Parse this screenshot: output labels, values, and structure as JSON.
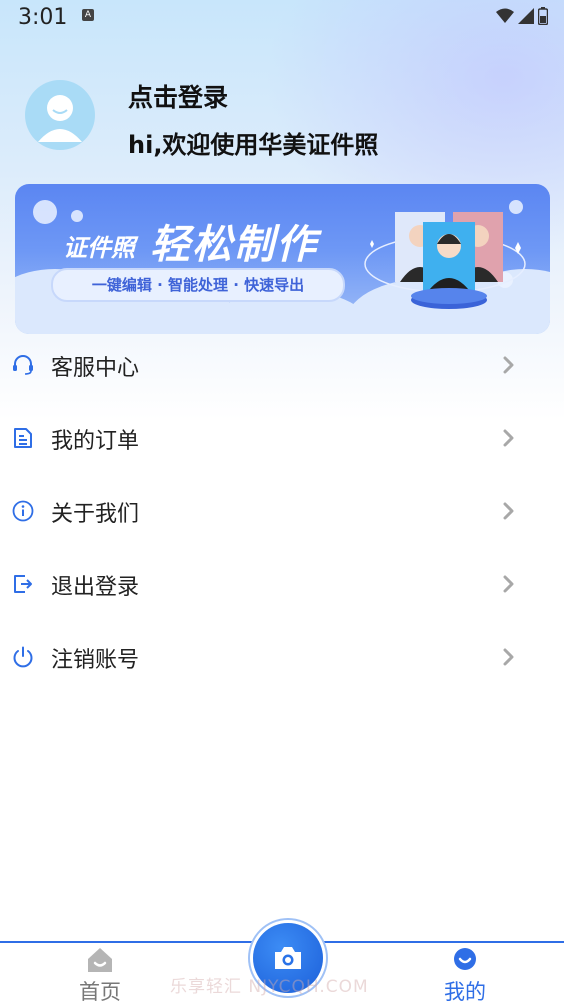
{
  "status_bar": {
    "time": "3:01",
    "notification_icon": "a-icon"
  },
  "profile": {
    "login_label": "点击登录",
    "welcome_text": "hi,欢迎使用华美证件照",
    "avatar_icon": "user-avatar-icon"
  },
  "banner": {
    "title_small": "证件照",
    "title_big": "轻松制作",
    "features": "一键编辑 · 智能处理 · 快速导出"
  },
  "menu": {
    "items": [
      {
        "label": "客服中心",
        "icon": "headset-icon"
      },
      {
        "label": "我的订单",
        "icon": "order-icon"
      },
      {
        "label": "关于我们",
        "icon": "info-icon"
      },
      {
        "label": "退出登录",
        "icon": "logout-icon"
      },
      {
        "label": "注销账号",
        "icon": "power-icon"
      }
    ]
  },
  "tabbar": {
    "home_label": "首页",
    "camera_icon": "camera-icon",
    "mine_label": "我的",
    "active_color": "#2f6ee6"
  },
  "watermark": "乐享轻汇 NJYCQH.COM"
}
